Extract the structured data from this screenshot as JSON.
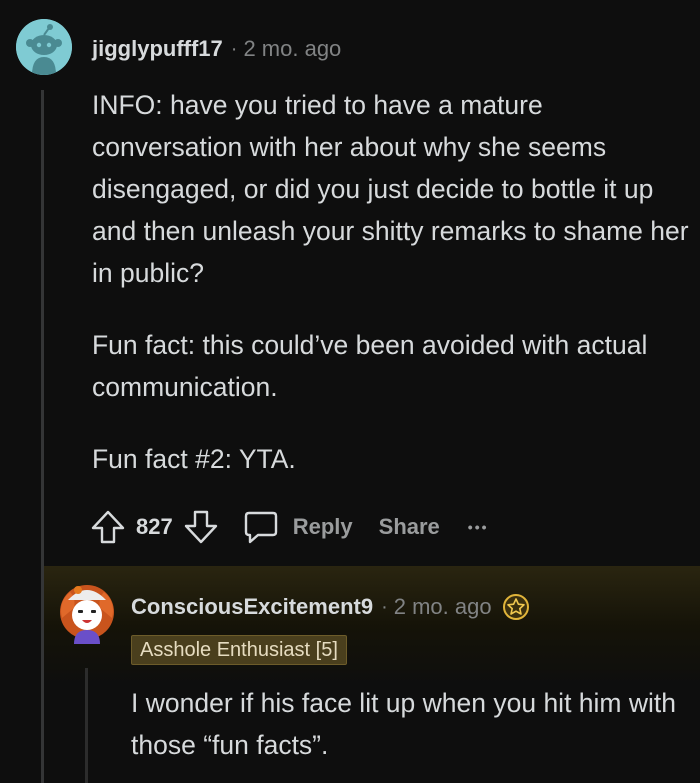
{
  "comments": [
    {
      "username": "jigglypufff17",
      "separator": "·",
      "age": "2 mo. ago",
      "avatar_icon": "snoo-avatar-icon",
      "paragraphs": [
        "INFO: have you tried to have a mature conversation with her about why she seems disengaged, or did you just decide to bottle it up and then unleash your shitty remarks to shame her in public?",
        "Fun fact: this could’ve been avoided with actual communication.",
        "Fun fact #2: YTA."
      ],
      "actions": {
        "vote_count": "827",
        "reply_label": "Reply",
        "share_label": "Share",
        "more_label": "•••"
      }
    },
    {
      "username": "ConsciousExcitement9",
      "separator": "·",
      "age": "2 mo. ago",
      "avatar_icon": "cartoon-avatar-icon",
      "award_icon": "award-icon",
      "flair": "Asshole Enthusiast [5]",
      "paragraphs": [
        "I wonder if his face lit up when you hit him with those “fun facts”."
      ]
    }
  ],
  "colors": {
    "background": "#0e0e0e",
    "text": "#d7dadc",
    "muted": "#818384",
    "thread_line": "#343536",
    "avatar_bg": "#7fcbd3",
    "flair_bg": "#4a3f1d"
  }
}
